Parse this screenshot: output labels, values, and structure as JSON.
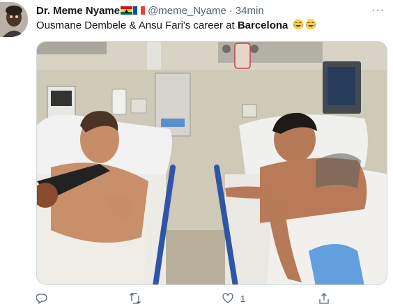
{
  "author": {
    "display_name": "Dr. Meme Nyame",
    "handle": "@meme_Nyame",
    "separator": "·",
    "timestamp": "34min",
    "flags": [
      "ghana-flag-icon",
      "france-flag-icon"
    ]
  },
  "tweet": {
    "text_before": "Ousmane Dembele & Ansu Fari's career at ",
    "text_bold": "Barcelona",
    "emojis": [
      "joy-emoji",
      "joy-emoji"
    ],
    "image_alt": "Two men laughing while sitting in hospital beds"
  },
  "actions": {
    "reply_count": "",
    "retweet_count": "",
    "like_count": "1",
    "share_count": ""
  },
  "more_label": "···",
  "colors": {
    "text": "#0f1419",
    "secondary": "#536471",
    "border": "#cfd9de"
  }
}
